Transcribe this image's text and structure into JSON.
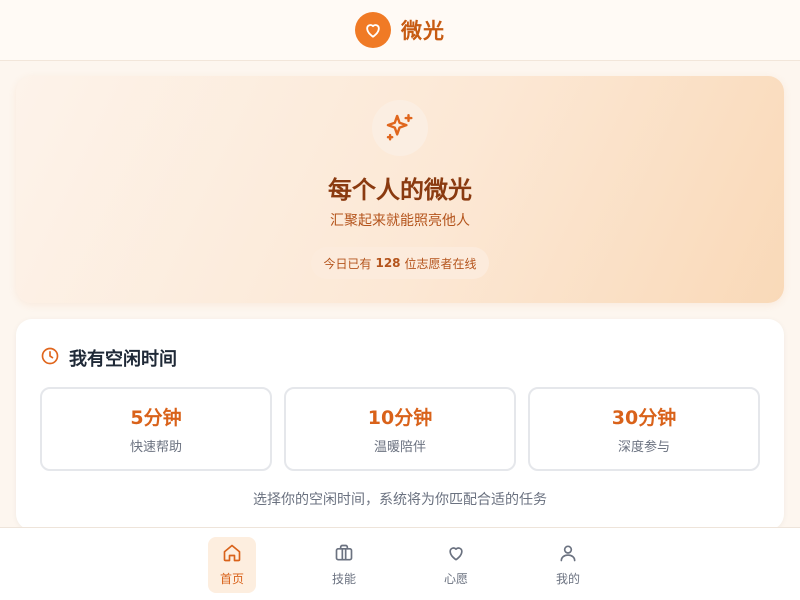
{
  "app": {
    "name": "微光"
  },
  "hero": {
    "title": "每个人的微光",
    "subtitle": "汇聚起来就能照亮他人",
    "online_prefix": "今日已有",
    "online_count": "128",
    "online_suffix": "位志愿者在线"
  },
  "free_time": {
    "title": "我有空闲时间",
    "options": [
      {
        "duration": "5分钟",
        "desc": "快速帮助"
      },
      {
        "duration": "10分钟",
        "desc": "温暖陪伴"
      },
      {
        "duration": "30分钟",
        "desc": "深度参与"
      }
    ],
    "hint": "选择你的空闲时间，系统将为你匹配合适的任务"
  },
  "nav": {
    "items": [
      {
        "label": "首页",
        "icon": "home-icon",
        "active": true
      },
      {
        "label": "技能",
        "icon": "briefcase-icon",
        "active": false
      },
      {
        "label": "心愿",
        "icon": "heart-icon",
        "active": false
      },
      {
        "label": "我的",
        "icon": "user-icon",
        "active": false
      }
    ]
  },
  "colors": {
    "accent": "#f07a25",
    "accent_dark": "#d9621a",
    "hero_title": "#8a3a10"
  }
}
